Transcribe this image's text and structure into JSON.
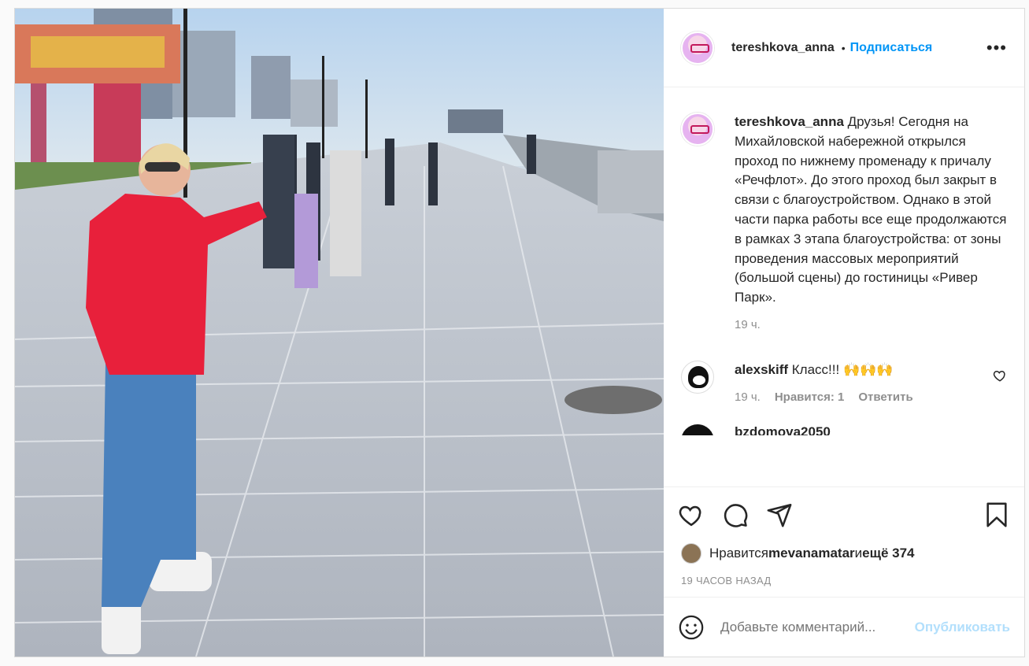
{
  "post": {
    "username": "tereshkova_anna",
    "separator": "•",
    "follow_label": "Подписаться",
    "more_label": "•••",
    "caption_user": "tereshkova_anna",
    "caption_text": " Друзья! Сегодня на Михайловской набережной открылся проход по нижнему променаду к причалу «Речфлот». До этого проход был закрыт в связи с благоустройством. Однако в этой части парка работы все еще продолжаются в рамках 3 этапа благоустройства: от зоны проведения массовых мероприятий (большой сцены) до гостиницы «Ривер Парк».",
    "caption_time": "19 ч.",
    "comments": [
      {
        "user": "alexskiff",
        "text": " Класс!!! 🙌🙌🙌",
        "time": "19 ч.",
        "likes": "Нравится: 1",
        "reply": "Ответить"
      }
    ],
    "third_comment_user": "bzdomova2050",
    "likes_prefix": "Нравится ",
    "likes_user": "mevanamatar",
    "likes_mid": " и ",
    "likes_count": "ещё 374",
    "timestamp": "19 ЧАСОВ НАЗАД",
    "comment_placeholder": "Добавьте комментарий...",
    "publish_label": "Опубликовать"
  }
}
